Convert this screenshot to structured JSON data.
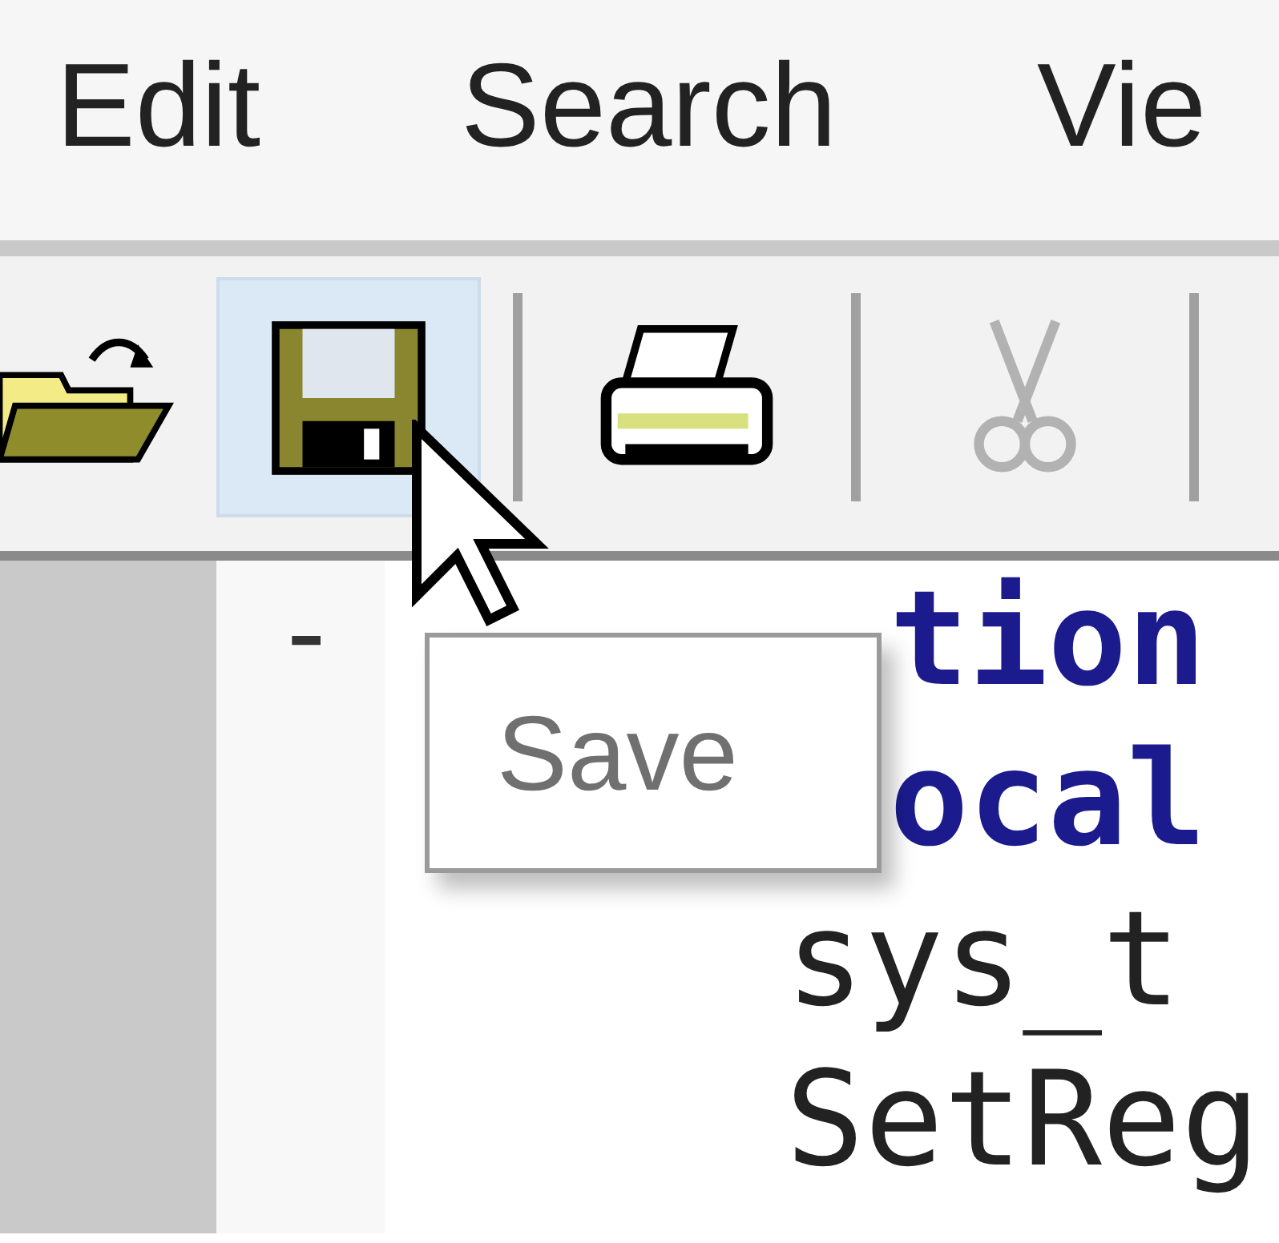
{
  "menu": [
    {
      "label": "Edit"
    },
    {
      "label": "Search"
    },
    {
      "label": "Vie"
    }
  ],
  "toolbar": [
    {
      "kind": "open",
      "disabled": false,
      "hovered": false
    },
    {
      "kind": "save",
      "disabled": false,
      "hovered": true
    },
    {
      "kind": "separator"
    },
    {
      "kind": "print",
      "disabled": false,
      "hovered": false
    },
    {
      "kind": "separator"
    },
    {
      "kind": "cut",
      "disabled": true,
      "hovered": false
    },
    {
      "kind": "separator"
    }
  ],
  "editor": {
    "fold_marker": "-",
    "lines": [
      {
        "text": "tion",
        "kind": "keyword"
      },
      {
        "text": "ocal",
        "kind": "keyword"
      },
      {
        "text": "sys_t",
        "kind": "plain"
      },
      {
        "text": "SetReg",
        "kind": "plain"
      }
    ]
  },
  "tooltip": {
    "text": "Save"
  }
}
